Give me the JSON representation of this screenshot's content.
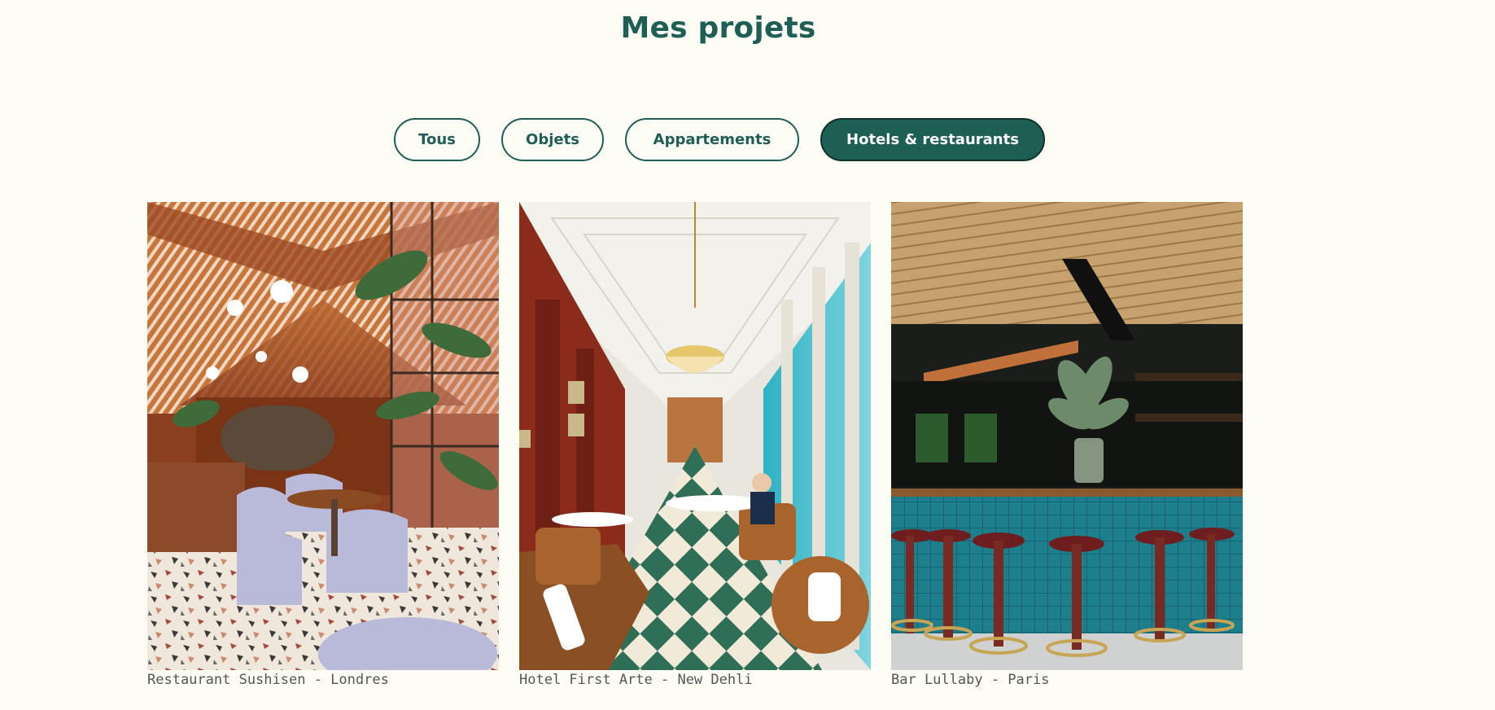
{
  "page": {
    "title": "Mes projets"
  },
  "filters": [
    {
      "label": "Tous",
      "active": false
    },
    {
      "label": "Objets",
      "active": false
    },
    {
      "label": "Appartements",
      "active": false
    },
    {
      "label": "Hotels & restaurants",
      "active": true
    }
  ],
  "projects": [
    {
      "caption": "Restaurant Sushisen - Londres"
    },
    {
      "caption": "Hotel First Arte - New Dehli"
    },
    {
      "caption": "Bar Lullaby - Paris"
    }
  ],
  "colors": {
    "accent": "#1e5f55",
    "background": "#fdfdf6",
    "caption": "#555555"
  }
}
